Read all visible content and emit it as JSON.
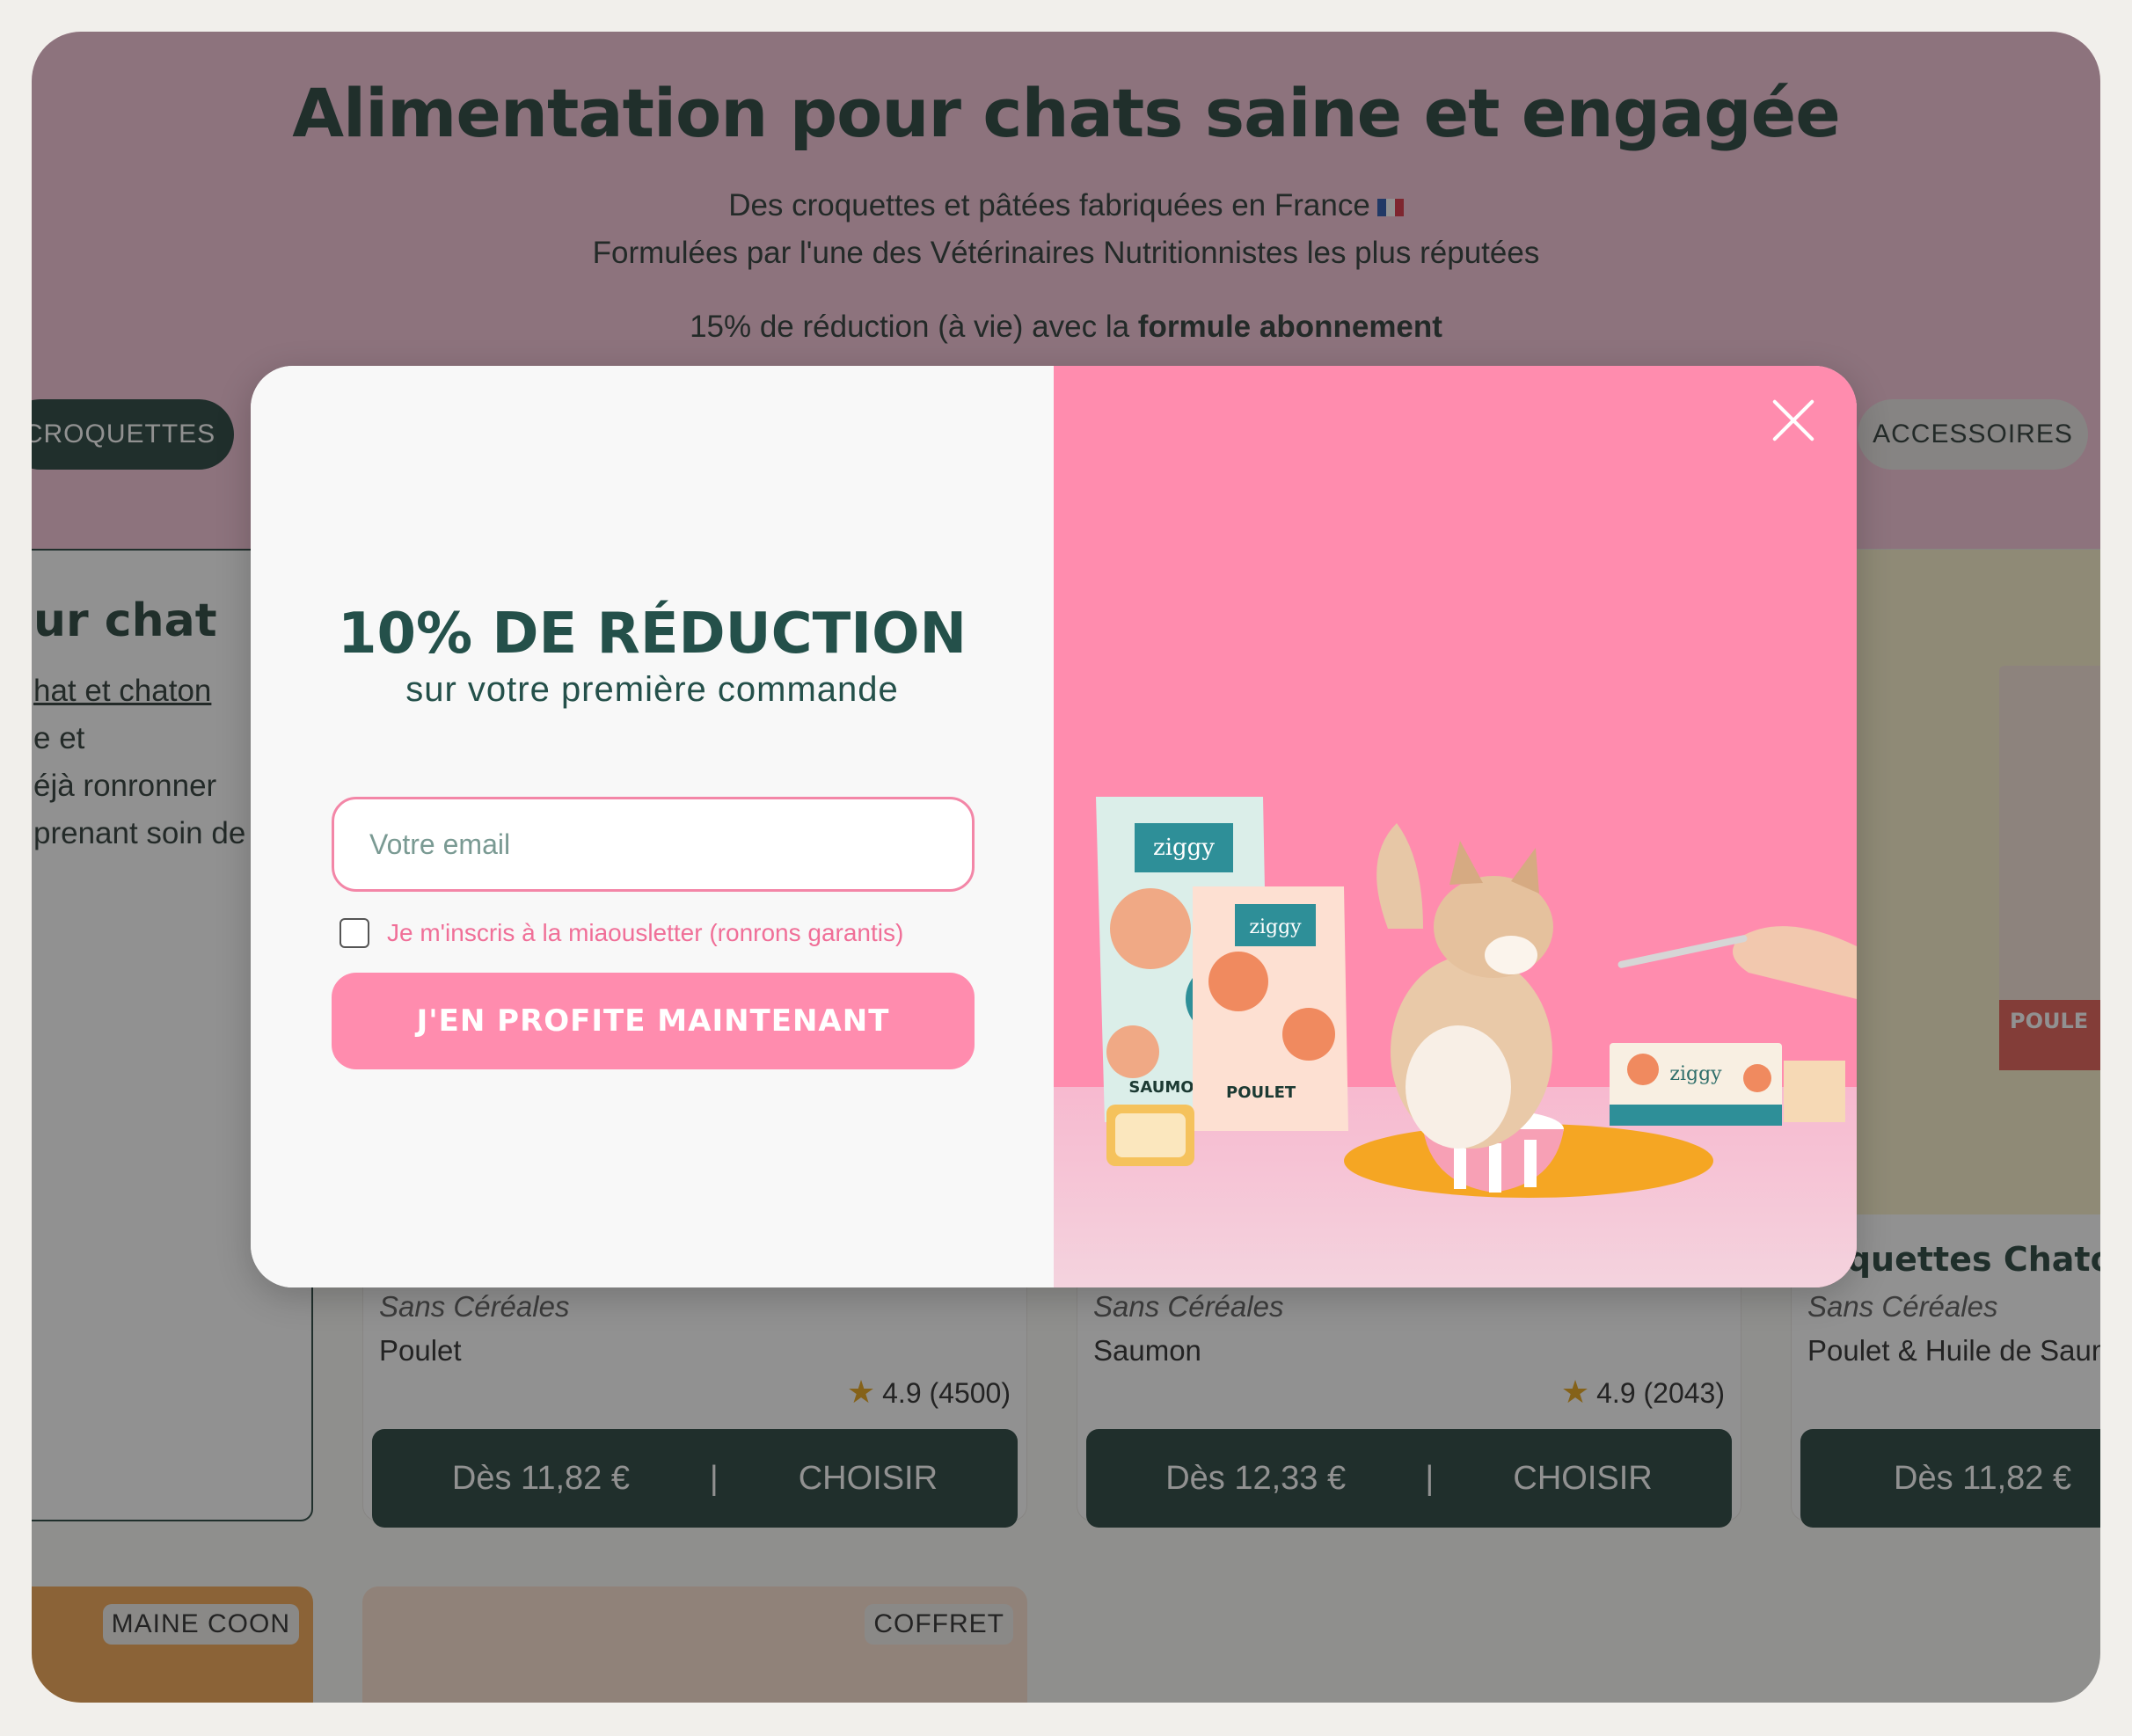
{
  "hero": {
    "title": "Alimentation pour chats saine et engagée",
    "line1": "Des croquettes et pâtées fabriquées en France",
    "line2": "Formulées par l'une des Vétérinaires Nutritionnistes les plus réputées",
    "promo_prefix": "15% de réduction (à vie) avec la ",
    "promo_bold": "formule abonnement"
  },
  "categories": {
    "croquettes": "CROQUETTES",
    "accessoires": "ACCESSOIRES"
  },
  "side_card": {
    "title": "ur chat",
    "lines": [
      "hat et chaton",
      "e et",
      "éjà ronronner",
      "prenant soin de"
    ]
  },
  "products": [
    {
      "category": "Sans Céréales",
      "flavour": "Poulet",
      "rating": "4.9",
      "reviews": "(4500)",
      "price": "Dès 11,82 €",
      "separator": "|",
      "cta": "CHOISIR"
    },
    {
      "category": "Sans Céréales",
      "flavour": "Saumon",
      "rating": "4.9",
      "reviews": "(2043)",
      "price": "Dès 12,33 €",
      "separator": "|",
      "cta": "CHOISIR"
    },
    {
      "name": "roquettes Chato",
      "category": "Sans Céréales",
      "flavour": "Poulet & Huile de Saum",
      "price": "Dès 11,82 €",
      "pack_label": "POULE"
    }
  ],
  "bottom_tags": [
    "MAINE COON",
    "COFFRET"
  ],
  "modal": {
    "title": "10% DE RÉDUCTION",
    "subtitle": "sur votre première commande",
    "email_placeholder": "Votre email",
    "checkbox_label": "Je m'inscris à la miaousletter (ronrons garantis)",
    "cta": "J'EN PROFITE MAINTENANT",
    "brand": "ziggy",
    "pack_labels": [
      "SAUMON",
      "POULET"
    ]
  },
  "colors": {
    "brand_dark": "#1d3a34",
    "modal_pink": "#ff8cae",
    "hero_pink": "#f7c2d7",
    "star": "#e7a10e"
  }
}
